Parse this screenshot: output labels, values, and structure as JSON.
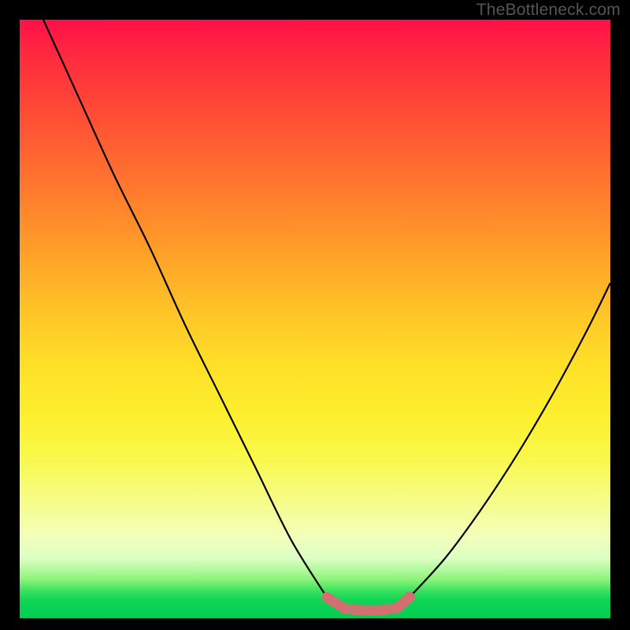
{
  "attribution": "TheBottleneck.com",
  "chart_data": {
    "type": "line",
    "title": "",
    "xlabel": "",
    "ylabel": "",
    "xlim": [
      0,
      100
    ],
    "ylim": [
      0,
      100
    ],
    "grid": false,
    "legend": false,
    "series": [
      {
        "name": "left-branch",
        "stroke": "#000000",
        "x": [
          4,
          10,
          16,
          22,
          28,
          34,
          40,
          46,
          52
        ],
        "y": [
          100,
          87,
          74,
          62,
          49,
          37,
          25,
          13,
          3.5
        ],
        "note": "Descending near-linear curve from top-left toward valley floor"
      },
      {
        "name": "right-branch",
        "stroke": "#000000",
        "x": [
          66,
          72,
          78,
          84,
          90,
          96,
          100
        ],
        "y": [
          3.5,
          10,
          18,
          27,
          37,
          48,
          56
        ],
        "note": "Ascending convex curve from valley floor toward upper-right"
      },
      {
        "name": "valley-floor",
        "stroke": "#d07070",
        "x": [
          52,
          55,
          58,
          61,
          64,
          66
        ],
        "y": [
          3.5,
          1.6,
          1.3,
          1.3,
          1.7,
          3.5
        ],
        "note": "Thick salmon segment along the bottom of the V; slight flat trough"
      }
    ],
    "annotations": [
      {
        "name": "valley-dot",
        "shape": "circle",
        "x": 66,
        "y": 3.5,
        "color": "#d07070"
      }
    ]
  }
}
